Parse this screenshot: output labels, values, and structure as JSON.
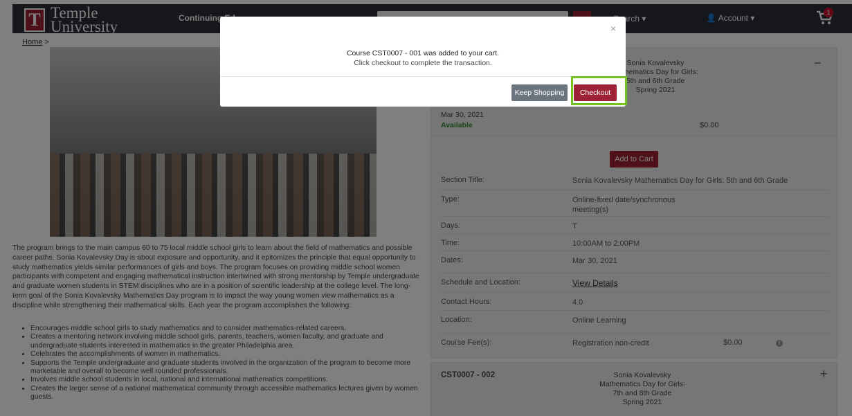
{
  "header": {
    "logo_line1": "Temple",
    "logo_line2": "University",
    "logo_mark": "T",
    "site_name": "Continuing Ed",
    "search_dropdown": "Search",
    "account": "Account",
    "cart_count": "1"
  },
  "breadcrumb": {
    "home": "Home",
    "sep": ">"
  },
  "description": "The program brings to the main campus 60 to 75 local middle school girls to learn about the field of mathematics and possible career paths. Sonia Kovalevsky Day is about exposure and opportunity, and it epitomizes the principle that equal opportunity to study mathematics yields similar performances of girls and boys. The program focuses on providing middle school women participants with competent and engaging mathematical instruction intertwined with strong mentorship by Temple undergraduate and graduate women students in STEM disciplines who are in a position of scientific leadership at the college level. The long-term goal of the Sonia Kovalevsky Mathematics Day program is to impact the way young women view mathematics as a discipline while strengthening their mathematical skills. Each year the program accomplishes the following:",
  "bullets": [
    "Encourages middle school girls to study mathematics and to consider mathematics-related careers.",
    "Creates a mentoring network involving middle school girls, parents, teachers, women faculty, and graduate and undergraduate students interested in mathematics in the greater Philadelphia area.",
    "Celebrates the accomplishments of women in mathematics.",
    "Supports the Temple undergraduate and graduate students involved in the organization of the program to become more marketable and overall to become well rounded professionals.",
    "Involves middle school students in local, national and international mathematics competitions.",
    "Creates the larger sense of a national mathematical community through accessible mathematics lectures given by women guests."
  ],
  "section1": {
    "title_lines": [
      "Sonia Kovalevsky",
      "Mathematics Day for Girls:",
      "5th and 6th Grade",
      "Spring 2021"
    ],
    "date": "Mar 30, 2021",
    "status": "Available",
    "price": "$0.00",
    "add_to_cart": "Add to Cart",
    "details": [
      {
        "k": "Section Title:",
        "v": "Sonia Kovalevsky Mathematics Day for Girls: 5th and 6th Grade"
      },
      {
        "k": "Type:",
        "v": "Online-fixed date/synchronous meeting(s)"
      },
      {
        "k": "Days:",
        "v": "T"
      },
      {
        "k": "Time:",
        "v": "10:00AM to 2:00PM"
      },
      {
        "k": "Dates:",
        "v": "Mar 30, 2021"
      },
      {
        "k": "Schedule and Location:",
        "v": "View Details"
      },
      {
        "k": "Contact Hours:",
        "v": "4.0"
      },
      {
        "k": "Location:",
        "v": "Online Learning"
      },
      {
        "k": "Course Fee(s):",
        "v": "Registration non-credit",
        "v2": "$0.00"
      }
    ]
  },
  "section2": {
    "code": "CST0007 - 002",
    "title_lines": [
      "Sonia Kovalevsky",
      "Mathematics Day for Girls:",
      "7th and 8th Grade",
      "Spring 2021"
    ]
  },
  "modal": {
    "message": "Course CST0007 - 001 was added to your cart.",
    "sub": "Click checkout to complete the transaction.",
    "keep_shopping": "Keep Shopping",
    "checkout": "Checkout",
    "close": "×"
  },
  "colors": {
    "brand": "#9d2235",
    "highlight": "#76c21f",
    "header": "#2a2f36"
  }
}
